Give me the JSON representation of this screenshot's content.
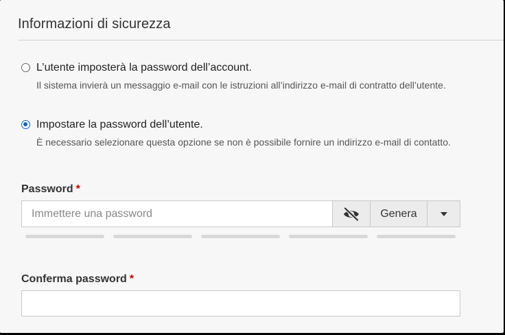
{
  "section": {
    "title": "Informazioni di sicurezza"
  },
  "options": [
    {
      "label": "L’utente imposterà la password dell’account.",
      "description": "Il sistema invierà un messaggio e-mail con le istruzioni all’indirizzo e-mail di contratto dell’utente.",
      "selected": false
    },
    {
      "label": "Impostare la password dell’utente.",
      "description": "È necessario selezionare questa opzione se non è possibile fornire un indirizzo e-mail di contatto.",
      "selected": true
    }
  ],
  "password": {
    "label": "Password",
    "required_mark": "*",
    "value": "",
    "placeholder": "Immettere una password",
    "visibility_icon": "eye-slash-icon",
    "generate_label": "Genera",
    "dropdown_icon": "caret-down-icon",
    "strength_segments_filled": 0,
    "strength_segments_total": 5
  },
  "confirm_password": {
    "label": "Conferma password",
    "required_mark": "*",
    "value": ""
  },
  "colors": {
    "accent": "#0d5fd6",
    "required": "#cc0000",
    "background": "#f7f7f7",
    "strength_empty": "#d8d8d8"
  }
}
